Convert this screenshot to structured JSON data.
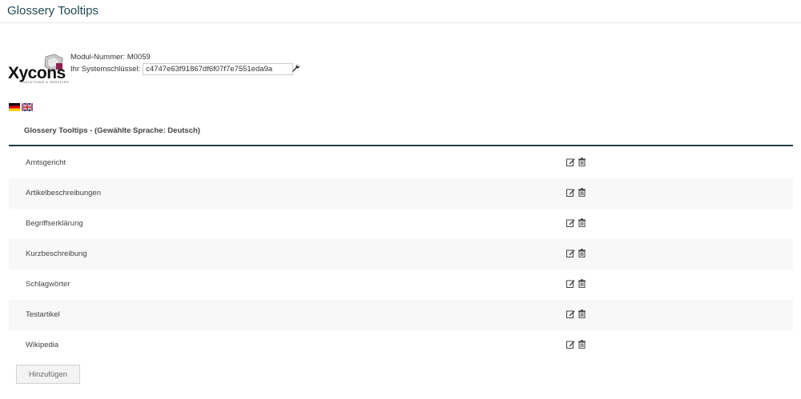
{
  "header": {
    "title": "Glossery Tooltips"
  },
  "module": {
    "number_label": "Modul-Nummer: M0059",
    "key_label": "Ihr Systemschlüssel:",
    "key_value": "c4747e63f91867df6f07f7e7551eda9a",
    "logo_text": "Xycons",
    "logo_subtext": "SOLUTIONS & SERVICES",
    "wrench_icon": "wrench-icon"
  },
  "languages": [
    {
      "name": "Deutsch",
      "icon": "german-flag-icon"
    },
    {
      "name": "English",
      "icon": "uk-flag-icon"
    }
  ],
  "section": {
    "title": "Glossery Tooltips - (Gewählte Sprache: Deutsch)"
  },
  "items": [
    {
      "label": "Amtsgericht"
    },
    {
      "label": "Artikelbeschreibungen"
    },
    {
      "label": "Begriffserklärung"
    },
    {
      "label": "Kurzbeschreibung"
    },
    {
      "label": "Schlagwörter"
    },
    {
      "label": "Testartikel"
    },
    {
      "label": "Wikipedia"
    }
  ],
  "actions": {
    "edit_icon": "edit-icon",
    "delete_icon": "trash-icon"
  },
  "add_button": {
    "label": "Hinzufügen"
  },
  "colors": {
    "title": "#1f4a52",
    "divider": "#1f3e44",
    "row_alt": "#f8f8f8"
  }
}
